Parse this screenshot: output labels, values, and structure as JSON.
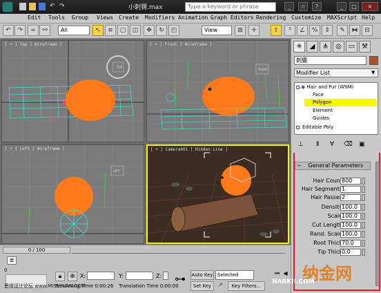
{
  "titlebar": {
    "title": "小刺猬.max",
    "search_placeholder": "Type a keyword or phrase"
  },
  "menu": [
    "Edit",
    "Tools",
    "Group",
    "Views",
    "Create",
    "Modifiers",
    "Animation",
    "Graph Editors",
    "Rendering",
    "Customize",
    "MAXScript",
    "Help"
  ],
  "toolbar": {
    "selection_filter": "All",
    "ref_coord": "View"
  },
  "viewports": {
    "top": "[ + ] Top ] Wireframe ]",
    "front": "[ + ] Front ] Wireframe ]",
    "left": "[ + ] Left ] Wireframe ]",
    "camera": "[ + ] Camera001 ] Hidden Line ]",
    "cube_left": "LEFT",
    "cube_top": "TOP",
    "cube_front": "FRONT"
  },
  "command_panel": {
    "object_name": "刺猬",
    "modifier_list": "Modifier List",
    "stack": [
      {
        "label": "Hair and Fur (WSM)",
        "level": 0,
        "selected": false
      },
      {
        "label": "Face",
        "level": 1,
        "selected": false
      },
      {
        "label": "Polygon",
        "level": 1,
        "selected": true
      },
      {
        "label": "Element",
        "level": 1,
        "selected": false
      },
      {
        "label": "Guides",
        "level": 1,
        "selected": false
      },
      {
        "label": "Editable Poly",
        "level": 0,
        "selected": false
      }
    ],
    "rollout_title": "General Parameters",
    "params": [
      {
        "label": "Hair Count",
        "value": "800"
      },
      {
        "label": "Hair Segments",
        "value": "1"
      },
      {
        "label": "Hair Passes",
        "value": "2"
      },
      {
        "label": "Density",
        "value": "100.0"
      },
      {
        "label": "Scale",
        "value": "100.0"
      },
      {
        "label": "Cut Length",
        "value": "100.0"
      },
      {
        "label": "Rand. Scale",
        "value": "100.0"
      },
      {
        "label": "Root Thick",
        "value": "70.0"
      },
      {
        "label": "Tip Thick",
        "value": "0.0"
      }
    ]
  },
  "bottom": {
    "timeline": "0 / 100",
    "x_label": "X:",
    "y_label": "Y:",
    "z_label": "Z:",
    "auto_key": "Auto Key",
    "selected": "Selected",
    "set_key": "Set Key",
    "key_filters": "Key Filters...",
    "rendering_time": "Rendering Time  0:00:26",
    "translation_time": "Translation Time  0:00:00",
    "tick_zero": "0"
  },
  "watermarks": {
    "site": "思缘设计论坛 www.MISSYUAN.COM",
    "brand": "纳金网",
    "brand_sub": "NARKII.COM"
  },
  "colors": {
    "selection_yellow": "#f7f700",
    "hedgehog_orange": "#ff7a1a",
    "wire_cyan": "#3de0d8",
    "highlight_red": "#d42020"
  }
}
